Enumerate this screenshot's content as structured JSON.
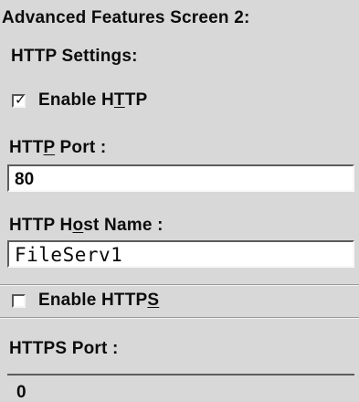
{
  "screen_title": "Advanced Features Screen 2:",
  "http_section": {
    "heading": "HTTP Settings:",
    "enable_http": {
      "label_prefix": "Enable H",
      "label_underlined": "T",
      "label_suffix": "TP",
      "checked": true
    },
    "port": {
      "label_prefix": "HTT",
      "label_underlined": "P",
      "label_suffix": " Port :",
      "value": "80"
    },
    "host_name": {
      "label_prefix": "HTTP H",
      "label_underlined": "o",
      "label_suffix": "st Name :",
      "value": "FileServ1"
    }
  },
  "https_section": {
    "enable_https": {
      "label_prefix": "Enable HTTP",
      "label_underlined": "S",
      "label_suffix": "",
      "checked": false
    },
    "port": {
      "label": "HTTPS Port :",
      "value": "0"
    }
  },
  "icons": {
    "check": "✓"
  }
}
